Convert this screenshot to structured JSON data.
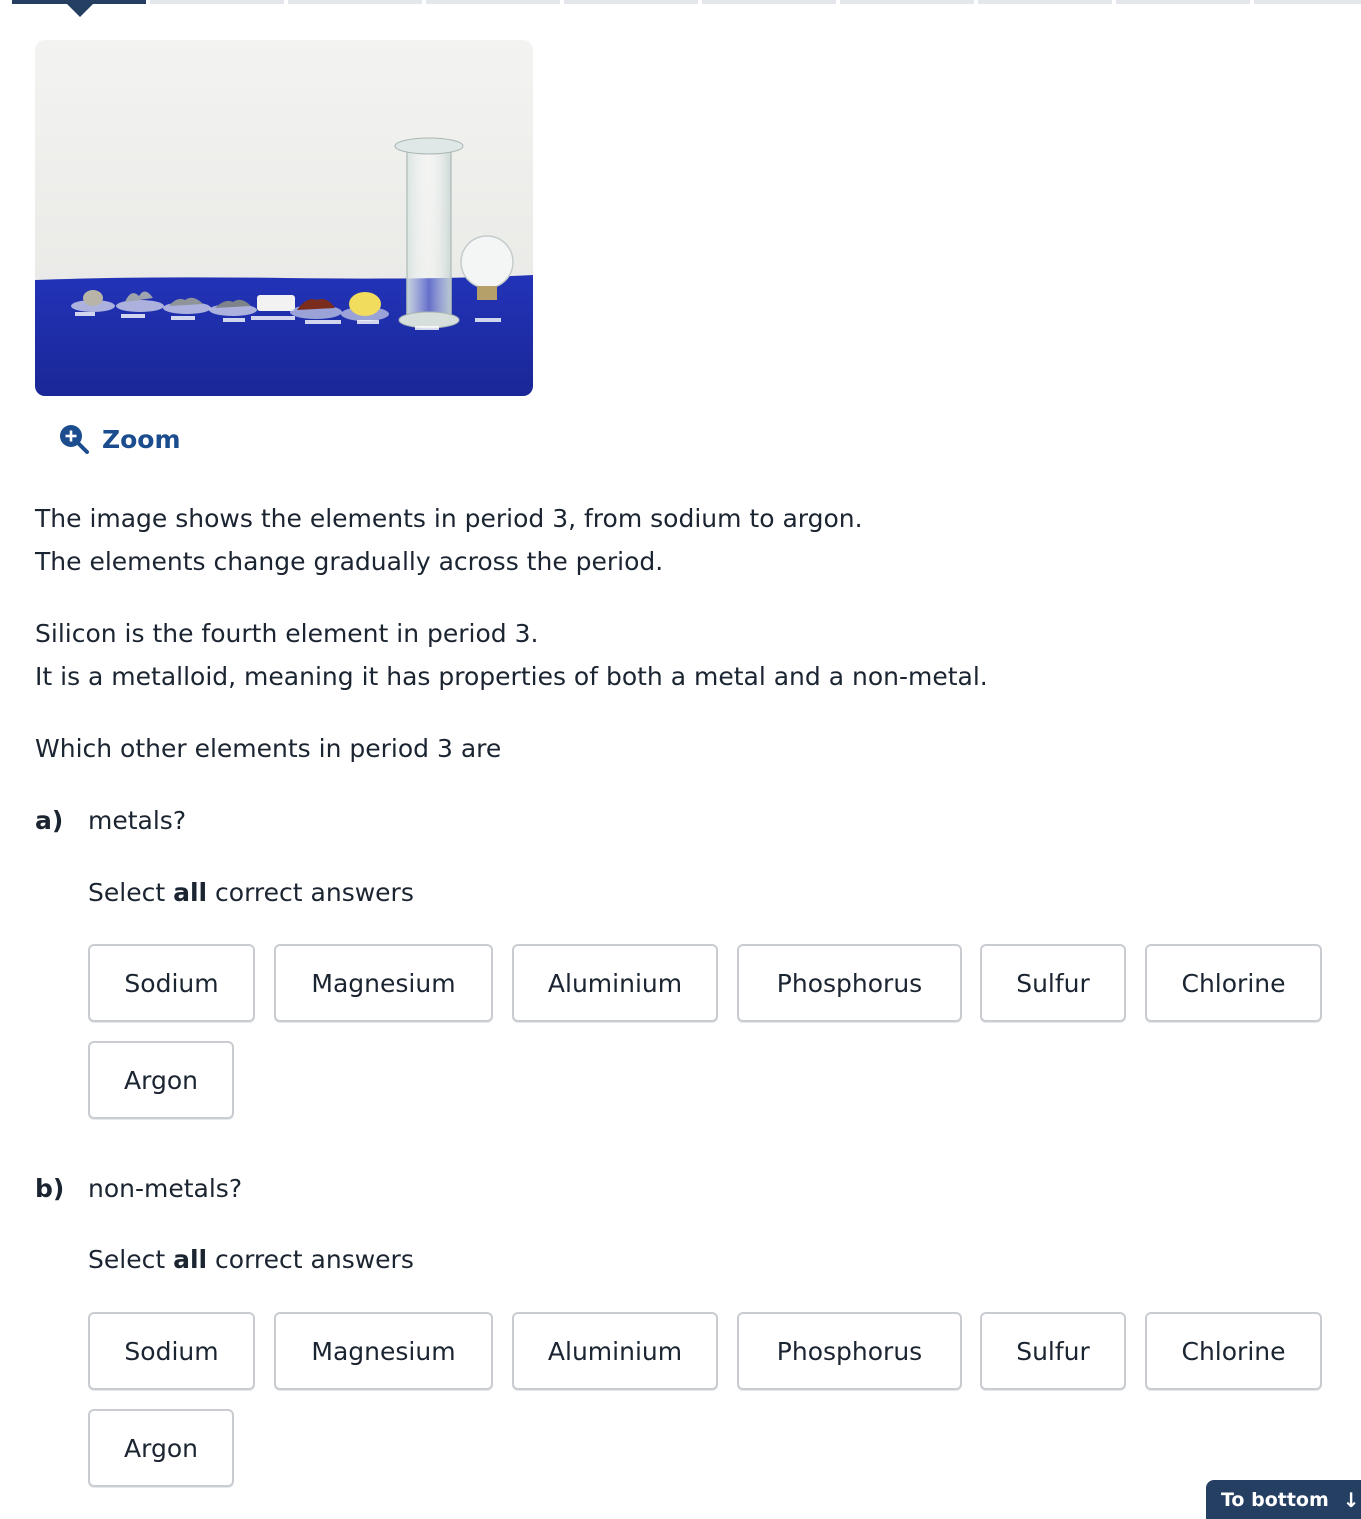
{
  "progress": {
    "segments": 10,
    "active_index": 0
  },
  "zoom": {
    "label": "Zoom",
    "icon": "zoom-in-icon"
  },
  "intro": [
    "The image shows the elements in period 3, from sodium to argon.",
    "The elements change gradually across the period."
  ],
  "context": [
    "Silicon is the fourth element in period 3.",
    "It is a metalloid, meaning it has properties of both a metal and a non-metal."
  ],
  "question": "Which other elements in period 3 are",
  "parts": [
    {
      "letter": "a)",
      "question": "metals?",
      "instruction_pre": "Select ",
      "instruction_bold": "all",
      "instruction_post": " correct answers",
      "options": [
        "Sodium",
        "Magnesium",
        "Aluminium",
        "Phosphorus",
        "Sulfur",
        "Chlorine",
        "Argon"
      ]
    },
    {
      "letter": "b)",
      "question": "non-metals?",
      "instruction_pre": "Select ",
      "instruction_bold": "all",
      "instruction_post": " correct answers",
      "options": [
        "Sodium",
        "Magnesium",
        "Aluminium",
        "Phosphorus",
        "Sulfur",
        "Chlorine",
        "Argon"
      ]
    }
  ],
  "to_bottom": {
    "label": "To bottom",
    "icon": "arrow-down-icon"
  },
  "colors": {
    "accent": "#253f63",
    "link": "#1b4c8d",
    "photo_table": "#1f2fb0"
  }
}
